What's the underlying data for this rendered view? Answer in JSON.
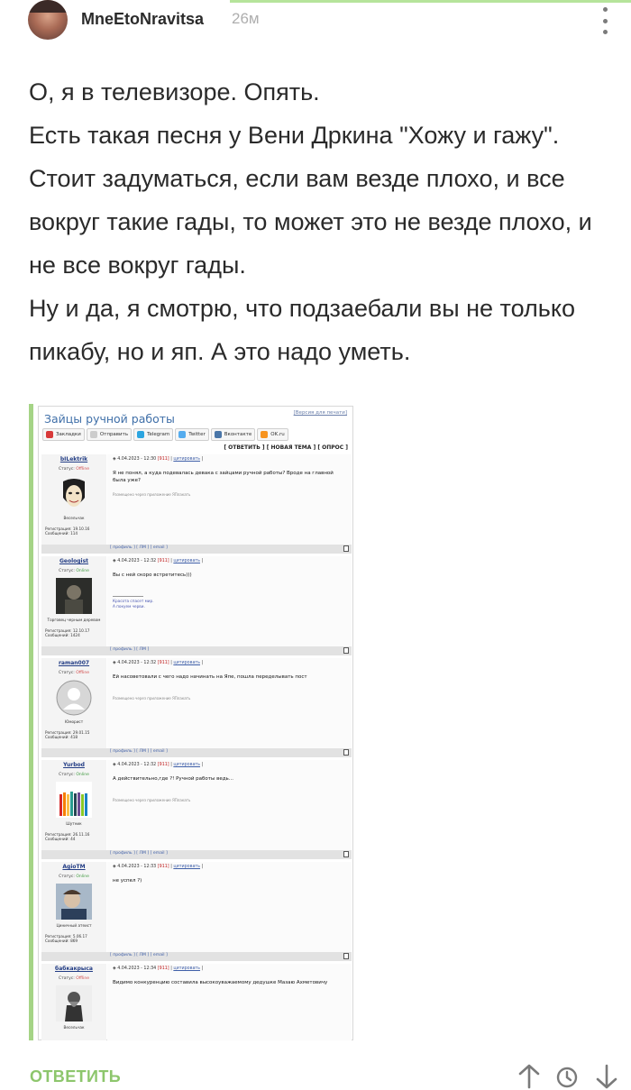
{
  "header": {
    "username": "MneEtoNravitsa",
    "time": "26м"
  },
  "comment": {
    "lines": [
      "О, я в телевизоре. Опять.",
      "Есть такая песня у Вени Дркина \"Хожу и гажу\".",
      "Стоит задуматься, если вам везде плохо, и все вокруг такие гады, то может это не везде плохо, и не все вокруг гады.",
      "Ну и да, я смотрю, что подзаебали вы не только пикабу, но и яп. А это надо уметь."
    ]
  },
  "forum": {
    "title": "Зайцы ручной работы",
    "print_link": "[Версия для печати]",
    "share": [
      "Закладки",
      "Отправить",
      "Telegram",
      "Twitter",
      "Вконтакте",
      "OK.ru"
    ],
    "share_colors": [
      "#d83a3a",
      "#cccccc",
      "#2ca5e0",
      "#55acee",
      "#4a76a8",
      "#f7931e"
    ],
    "actions": "[ ОТВЕТИТЬ ] [ НОВАЯ ТЕМА ] [ ОПРОС ]",
    "posts": [
      {
        "nick": "bILektrik",
        "status_label": "Статус:",
        "status": "Offline",
        "online": false,
        "title": "Весельчак",
        "reg": "Регистрация: 19.10.16",
        "count": "Сообщений: 114",
        "date": "4.04.2023 - 12:30",
        "num": "[911]",
        "quote": "цитировать",
        "message": "Я не понял, а куда подевалась девака с зайцами ручной работы? Вроде на главной была уже?",
        "via": "Размещено через приложение ЯПлакать",
        "signature": [],
        "footer": "[ профиль ] [ ЛМ ] [ email ]",
        "avatar": "mask"
      },
      {
        "nick": "Geologist",
        "status_label": "Статус:",
        "status": "Online",
        "online": true,
        "title": "Торговец черным деревом",
        "reg": "Регистрация: 12.10.17",
        "count": "Сообщений: 1424",
        "date": "4.04.2023 - 12:32",
        "num": "[911]",
        "quote": "цитировать",
        "message": "Вы с ней скоро встретитесь)))",
        "via": "",
        "signature": [
          "Красота спасет мир.",
          "А покуем черви."
        ],
        "footer": "[ профиль ] [ ЛМ ]",
        "avatar": "dark-photo"
      },
      {
        "nick": "raman007",
        "status_label": "Статус:",
        "status": "Offline",
        "online": false,
        "title": "Юморист",
        "reg": "Регистрация: 29.01.15",
        "count": "Сообщений: 418",
        "date": "4.04.2023 - 12:32",
        "num": "[911]",
        "quote": "цитировать",
        "message": "Ей насоветовали с чего надо начинать на Япе, пошла переделывать пост",
        "via": "Размещено через приложение ЯПлакать",
        "signature": [],
        "footer": "[ профиль ] [ ЛМ ] [ email ]",
        "avatar": "default"
      },
      {
        "nick": "Yurbod",
        "status_label": "Статус:",
        "status": "Online",
        "online": true,
        "title": "Шутник",
        "reg": "Регистрация: 26.11.16",
        "count": "Сообщений: 44",
        "date": "4.04.2023 - 12:32",
        "num": "[911]",
        "quote": "цитировать",
        "message": "А действительно,где ?! Ручной работы ведь...",
        "via": "Размещено через приложение ЯПлакать",
        "signature": [],
        "footer": "[ профиль ] [ ЛМ ] [ email ]",
        "avatar": "pencils"
      },
      {
        "nick": "AgioTM",
        "status_label": "Статус:",
        "status": "Online",
        "online": true,
        "title": "Циничный атеист",
        "reg": "Регистрация: 5.06.17",
        "count": "Сообщений: 869",
        "date": "4.04.2023 - 12:33",
        "num": "[911]",
        "quote": "цитировать",
        "message": "не успел ?)",
        "via": "",
        "signature": [],
        "footer": "[ профиль ] [ ЛМ ] [ email ]",
        "avatar": "photo"
      },
      {
        "nick": "бабкакрыса",
        "status_label": "Статус:",
        "status": "Offline",
        "online": false,
        "title": "Весельчак",
        "reg": "",
        "count": "",
        "date": "4.04.2023 - 12:34",
        "num": "[911]",
        "quote": "цитировать",
        "message": "Видимо конкуренцию составила высокоуважаемому дедушке Мазаю Ахметовичу",
        "via": "",
        "signature": [],
        "footer": "",
        "avatar": "engraving"
      }
    ]
  },
  "bottom": {
    "reply": "ОТВЕТИТЬ"
  },
  "colors": {
    "accent": "#8dc66c",
    "forum_border": "#a5d486",
    "forum_title": "#3f6fa8"
  },
  "icons": [
    "kebab-menu-icon",
    "arrow-up-icon",
    "history-icon",
    "arrow-down-icon"
  ]
}
